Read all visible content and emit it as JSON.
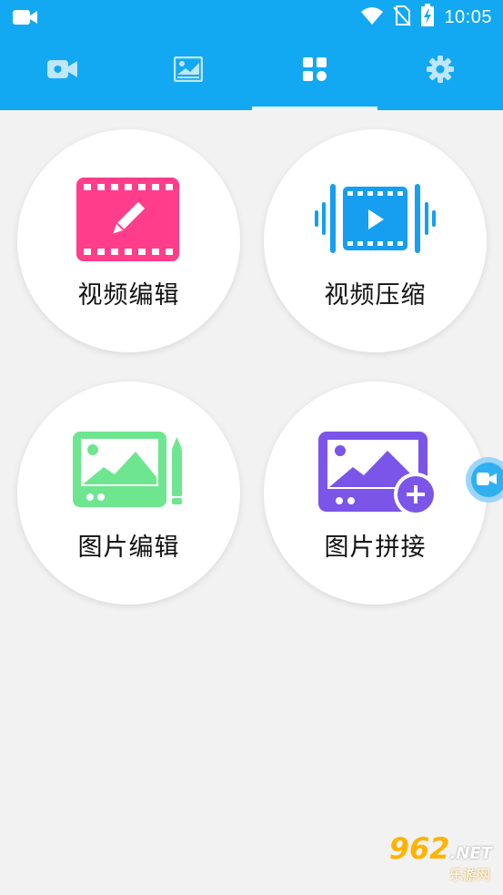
{
  "status_bar": {
    "time": "10:05"
  },
  "tabs": [
    {
      "icon": "video-camera-icon",
      "active": false
    },
    {
      "icon": "image-gallery-icon",
      "active": false
    },
    {
      "icon": "grid-apps-icon",
      "active": true
    },
    {
      "icon": "gear-icon",
      "active": false
    }
  ],
  "features": [
    {
      "label": "视频编辑",
      "icon": "video-edit-icon",
      "color": "#ff3d8b"
    },
    {
      "label": "视频压缩",
      "icon": "video-compress-icon",
      "color": "#169ef0"
    },
    {
      "label": "图片编辑",
      "icon": "image-edit-icon",
      "color": "#6ee68f"
    },
    {
      "label": "图片拼接",
      "icon": "image-join-icon",
      "color": "#7a55e8"
    }
  ],
  "watermark": {
    "brand": "962",
    "suffix": ".NET",
    "text": "乐游网"
  },
  "colors": {
    "header": "#12a8f2",
    "background": "#f2f2f2"
  }
}
